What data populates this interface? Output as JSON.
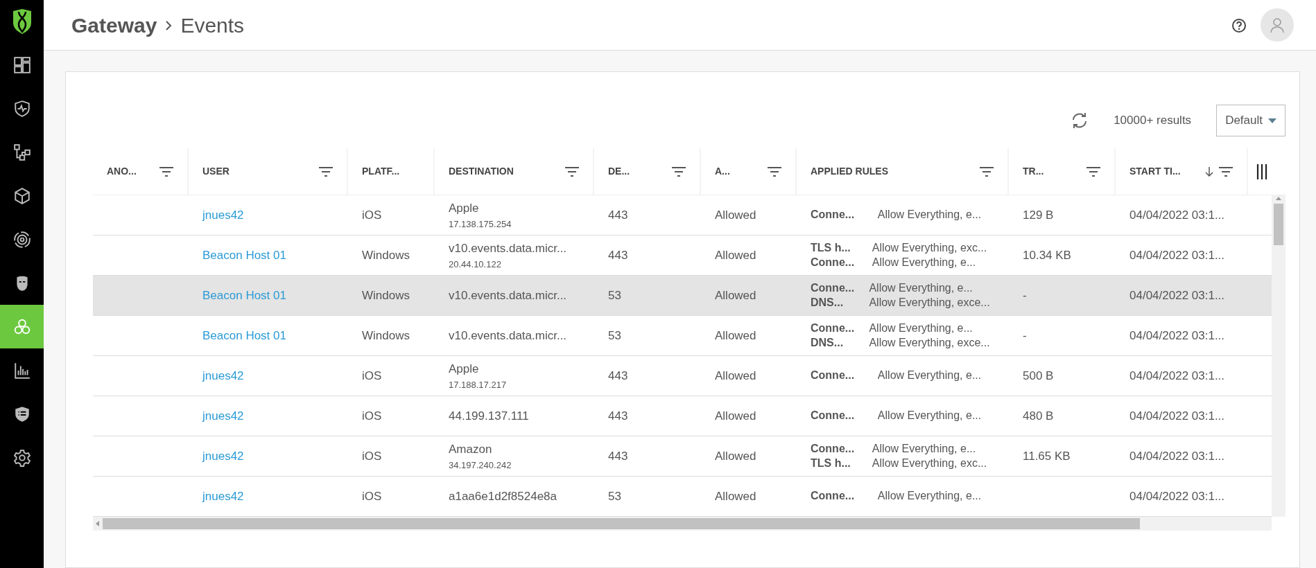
{
  "breadcrumb": [
    {
      "label": "Gateway"
    },
    {
      "label": "Events"
    }
  ],
  "sidebar": {
    "items": [
      {
        "selected": false
      },
      {
        "selected": false
      },
      {
        "selected": false
      },
      {
        "selected": false
      },
      {
        "selected": false
      },
      {
        "selected": false
      },
      {
        "selected": true
      },
      {
        "selected": false
      },
      {
        "selected": false
      },
      {
        "selected": false
      }
    ]
  },
  "toolbar": {
    "results": "10000+ results",
    "view_select": "Default"
  },
  "table": {
    "columns": [
      {
        "label": "ANO...",
        "filterable": true,
        "sorted": false
      },
      {
        "label": "USER",
        "filterable": true,
        "sorted": false
      },
      {
        "label": "PLATF...",
        "filterable": false,
        "sorted": false
      },
      {
        "label": "DESTINATION",
        "filterable": true,
        "sorted": false
      },
      {
        "label": "DE...",
        "filterable": true,
        "sorted": false
      },
      {
        "label": "A...",
        "filterable": true,
        "sorted": false
      },
      {
        "label": "APPLIED RULES",
        "filterable": true,
        "sorted": false
      },
      {
        "label": "TR...",
        "filterable": true,
        "sorted": false
      },
      {
        "label": "START TI...",
        "filterable": true,
        "sorted": true
      }
    ],
    "rows": [
      {
        "selected": false,
        "user": "jnues42",
        "platform": "iOS",
        "destination": "Apple",
        "destination_ip": "17.138.175.254",
        "port": "443",
        "action": "Allowed",
        "rules": [
          {
            "name": "Conne...",
            "policy": "Allow Everything, e..."
          }
        ],
        "transfer": "129 B",
        "start_time": "04/04/2022 03:1..."
      },
      {
        "selected": false,
        "user": "Beacon Host 01",
        "platform": "Windows",
        "destination": "v10.events.data.micr...",
        "destination_ip": "20.44.10.122",
        "port": "443",
        "action": "Allowed",
        "rules": [
          {
            "name": "TLS h...",
            "policy": "Allow Everything, exc..."
          },
          {
            "name": "Conne...",
            "policy": "Allow Everything, e..."
          }
        ],
        "transfer": "10.34 KB",
        "start_time": "04/04/2022 03:1..."
      },
      {
        "selected": true,
        "user": "Beacon Host 01",
        "platform": "Windows",
        "destination": "v10.events.data.micr...",
        "port": "53",
        "action": "Allowed",
        "rules": [
          {
            "name": "Conne...",
            "policy": "Allow Everything, e..."
          },
          {
            "name": "DNS...",
            "policy": "Allow Everything, exce..."
          }
        ],
        "transfer": "-",
        "start_time": "04/04/2022 03:1..."
      },
      {
        "selected": false,
        "user": "Beacon Host 01",
        "platform": "Windows",
        "destination": "v10.events.data.micr...",
        "port": "53",
        "action": "Allowed",
        "rules": [
          {
            "name": "Conne...",
            "policy": "Allow Everything, e..."
          },
          {
            "name": "DNS...",
            "policy": "Allow Everything, exce..."
          }
        ],
        "transfer": "-",
        "start_time": "04/04/2022 03:1..."
      },
      {
        "selected": false,
        "user": "jnues42",
        "platform": "iOS",
        "destination": "Apple",
        "destination_ip": "17.188.17.217",
        "port": "443",
        "action": "Allowed",
        "rules": [
          {
            "name": "Conne...",
            "policy": "Allow Everything, e..."
          }
        ],
        "transfer": "500 B",
        "start_time": "04/04/2022 03:1..."
      },
      {
        "selected": false,
        "user": "jnues42",
        "platform": "iOS",
        "destination": "44.199.137.111",
        "port": "443",
        "action": "Allowed",
        "rules": [
          {
            "name": "Conne...",
            "policy": "Allow Everything, e..."
          }
        ],
        "transfer": "480 B",
        "start_time": "04/04/2022 03:1..."
      },
      {
        "selected": false,
        "user": "jnues42",
        "platform": "iOS",
        "destination": "Amazon",
        "destination_ip": "34.197.240.242",
        "port": "443",
        "action": "Allowed",
        "rules": [
          {
            "name": "Conne...",
            "policy": "Allow Everything, e..."
          },
          {
            "name": "TLS h...",
            "policy": "Allow Everything, exc..."
          }
        ],
        "transfer": "11.65 KB",
        "start_time": "04/04/2022 03:1..."
      },
      {
        "selected": false,
        "user": "jnues42",
        "platform": "iOS",
        "destination": "a1aa6e1d2f8524e8a",
        "port": "53",
        "action": "Allowed",
        "rules": [
          {
            "name": "Conne...",
            "policy": "Allow Everything, e..."
          }
        ],
        "start_time": "04/04/2022 03:1..."
      }
    ]
  }
}
